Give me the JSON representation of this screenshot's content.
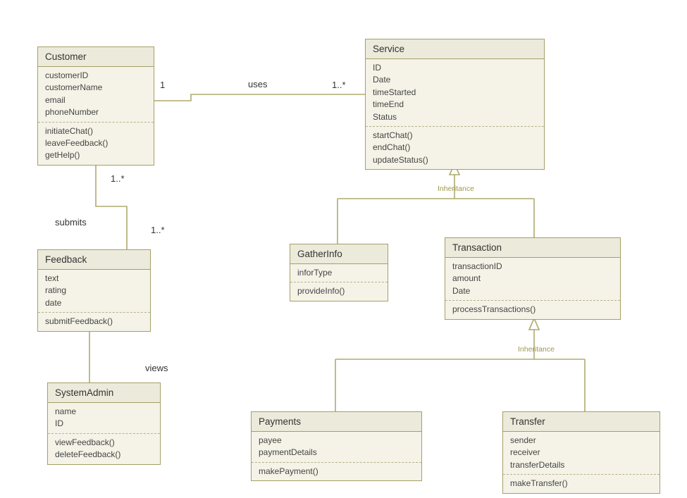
{
  "classes": {
    "customer": {
      "title": "Customer",
      "attrs": [
        "customerID",
        "customerName",
        "email",
        "phoneNumber"
      ],
      "ops": [
        "initiateChat()",
        "leaveFeedback()",
        "getHelp()"
      ]
    },
    "service": {
      "title": "Service",
      "attrs": [
        "ID",
        "Date",
        "timeStarted",
        "timeEnd",
        "Status"
      ],
      "ops": [
        "startChat()",
        "endChat()",
        "updateStatus()"
      ]
    },
    "feedback": {
      "title": "Feedback",
      "attrs": [
        "text",
        "rating",
        "date"
      ],
      "ops": [
        "submitFeedback()"
      ]
    },
    "systemAdmin": {
      "title": "SystemAdmin",
      "attrs": [
        "name",
        "ID"
      ],
      "ops": [
        "viewFeedback()",
        "deleteFeedback()"
      ]
    },
    "gatherInfo": {
      "title": "GatherInfo",
      "attrs": [
        "inforType"
      ],
      "ops": [
        "provideInfo()"
      ]
    },
    "transaction": {
      "title": "Transaction",
      "attrs": [
        "transactionID",
        "amount",
        "Date"
      ],
      "ops": [
        "processTransactions()"
      ]
    },
    "payments": {
      "title": "Payments",
      "attrs": [
        "payee",
        "paymentDetails"
      ],
      "ops": [
        "makePayment()"
      ]
    },
    "transfer": {
      "title": "Transfer",
      "attrs": [
        "sender",
        "receiver",
        "transferDetails"
      ],
      "ops": [
        "makeTransfer()"
      ]
    }
  },
  "labels": {
    "uses": "uses",
    "submits": "submits",
    "views": "views",
    "inheritance": "Inheritance",
    "one": "1",
    "one_many": "1..*",
    "one_many2": "1..*",
    "one_many3": "1..*"
  }
}
